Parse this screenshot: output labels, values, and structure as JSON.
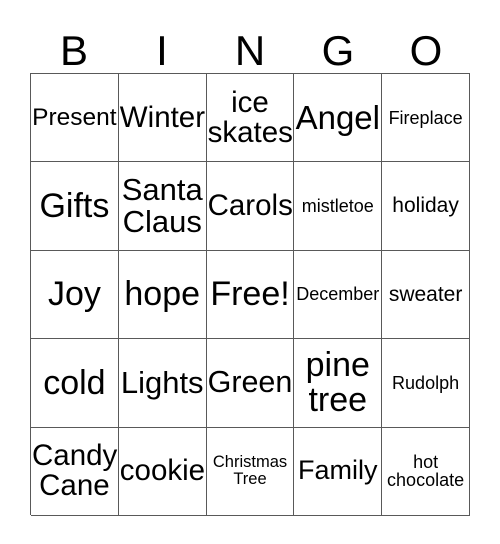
{
  "card": {
    "title_letters": [
      "B",
      "I",
      "N",
      "G",
      "O"
    ],
    "grid": {
      "columns": 5,
      "rows": 5,
      "border_color": "#595959",
      "background_color": "#ffffff",
      "text_color": "#000000",
      "cells": [
        [
          {
            "text": "Present",
            "size": "md"
          },
          {
            "text": "Winter",
            "size": "lg"
          },
          {
            "text": "ice\nskates",
            "size": "lg"
          },
          {
            "text": "Angel",
            "size": "xl"
          },
          {
            "text": "Fireplace",
            "size": "xs"
          }
        ],
        [
          {
            "text": "Gifts",
            "size": "xl"
          },
          {
            "text": "Santa\nClaus",
            "size": "lg"
          },
          {
            "text": "Carols",
            "size": "lg"
          },
          {
            "text": "mistletoe",
            "size": "xs"
          },
          {
            "text": "holiday",
            "size": "sm"
          }
        ],
        [
          {
            "text": "Joy",
            "size": "xl"
          },
          {
            "text": "hope",
            "size": "xl"
          },
          {
            "text": "Free!",
            "size": "xl"
          },
          {
            "text": "December",
            "size": "xs"
          },
          {
            "text": "sweater",
            "size": "sm"
          }
        ],
        [
          {
            "text": "cold",
            "size": "xl"
          },
          {
            "text": "Lights",
            "size": "lg"
          },
          {
            "text": "Green",
            "size": "lg"
          },
          {
            "text": "pine\ntree",
            "size": "xl"
          },
          {
            "text": "Rudolph",
            "size": "xs"
          }
        ],
        [
          {
            "text": "Candy\nCane",
            "size": "lg"
          },
          {
            "text": "cookie",
            "size": "lg"
          },
          {
            "text": "Christmas\nTree",
            "size": "xxs"
          },
          {
            "text": "Family",
            "size": "md"
          },
          {
            "text": "hot\nchocolate",
            "size": "xs"
          }
        ]
      ]
    }
  }
}
